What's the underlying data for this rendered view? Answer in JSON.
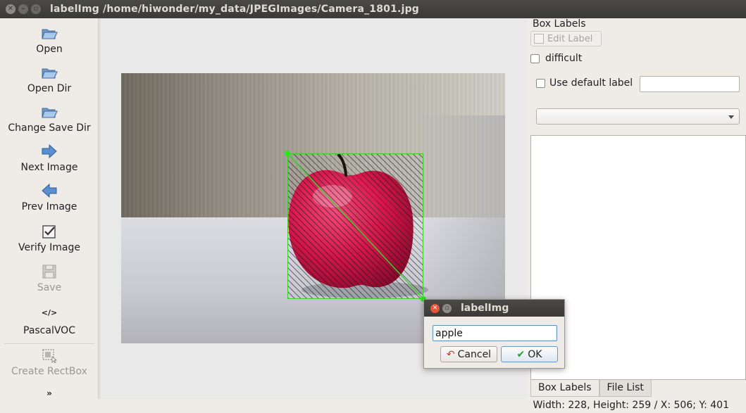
{
  "window": {
    "title": "labelImg /home/hiwonder/my_data/JPEGImages/Camera_1801.jpg",
    "controls": [
      "close",
      "minimize",
      "maximize"
    ]
  },
  "toolbar": {
    "items": [
      {
        "label": "Open",
        "icon": "folder-open-icon",
        "enabled": true
      },
      {
        "label": "Open Dir",
        "icon": "folder-open-icon",
        "enabled": true
      },
      {
        "label": "Change Save Dir",
        "icon": "folder-open-icon",
        "enabled": true
      },
      {
        "label": "Next Image",
        "icon": "arrow-right-icon",
        "enabled": true
      },
      {
        "label": "Prev Image",
        "icon": "arrow-left-icon",
        "enabled": true
      },
      {
        "label": "Verify Image",
        "icon": "checkbox-icon",
        "enabled": true
      },
      {
        "label": "Save",
        "icon": "floppy-icon",
        "enabled": false
      },
      {
        "label": "PascalVOC",
        "icon": "code-tag-icon",
        "icon_text": "</>",
        "enabled": true
      },
      {
        "label": "Create RectBox",
        "icon": "rectbox-icon",
        "enabled": false
      }
    ],
    "more_glyph": "»"
  },
  "dock": {
    "title": "Box Labels",
    "edit_label": "Edit Label",
    "difficult_label": "difficult",
    "use_default_label": "Use default label",
    "default_label_value": "",
    "combo_value": "",
    "tabs": [
      "Box Labels",
      "File List"
    ],
    "active_tab": "Box Labels"
  },
  "status": {
    "text": "Width: 228, Height: 259 / X: 506; Y: 401"
  },
  "dialog": {
    "title": "labelImg",
    "input_value": "apple",
    "cancel_label": "Cancel",
    "ok_label": "OK"
  },
  "colors": {
    "bbox_stroke": "#3ecf2c",
    "bbox_corner": "#27e61a",
    "apple": "#d4184a",
    "titlebar": "#3b3a37"
  }
}
